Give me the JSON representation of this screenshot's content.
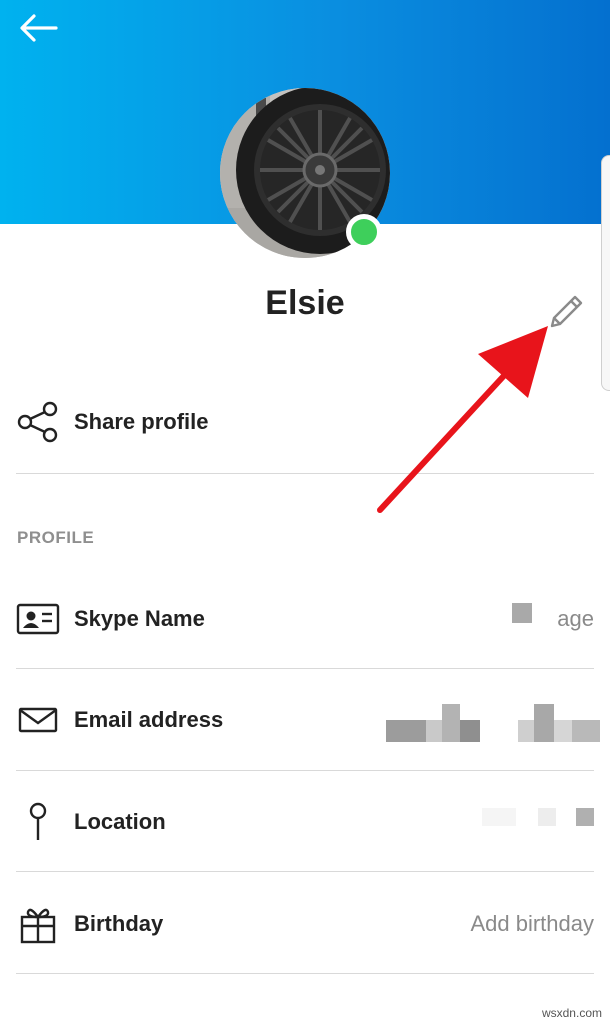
{
  "header": {
    "back_icon": "arrow-left-icon",
    "gradient": [
      "#00b2ef",
      "#0470cf"
    ]
  },
  "profile": {
    "name": "Elsie",
    "status_color": "#3ecf5b",
    "edit_icon": "pencil-icon"
  },
  "share": {
    "label": "Share profile",
    "icon": "share-icon"
  },
  "section": {
    "title": "PROFILE"
  },
  "rows": {
    "skype_name": {
      "label": "Skype Name",
      "value": "age",
      "icon": "id-card-icon"
    },
    "email": {
      "label": "Email address",
      "icon": "envelope-icon"
    },
    "location": {
      "label": "Location",
      "icon": "location-pin-icon"
    },
    "birthday": {
      "label": "Birthday",
      "value": "Add birthday",
      "icon": "gift-icon"
    }
  },
  "annotation": {
    "color": "#e8141b"
  },
  "watermark": "wsxdn.com"
}
